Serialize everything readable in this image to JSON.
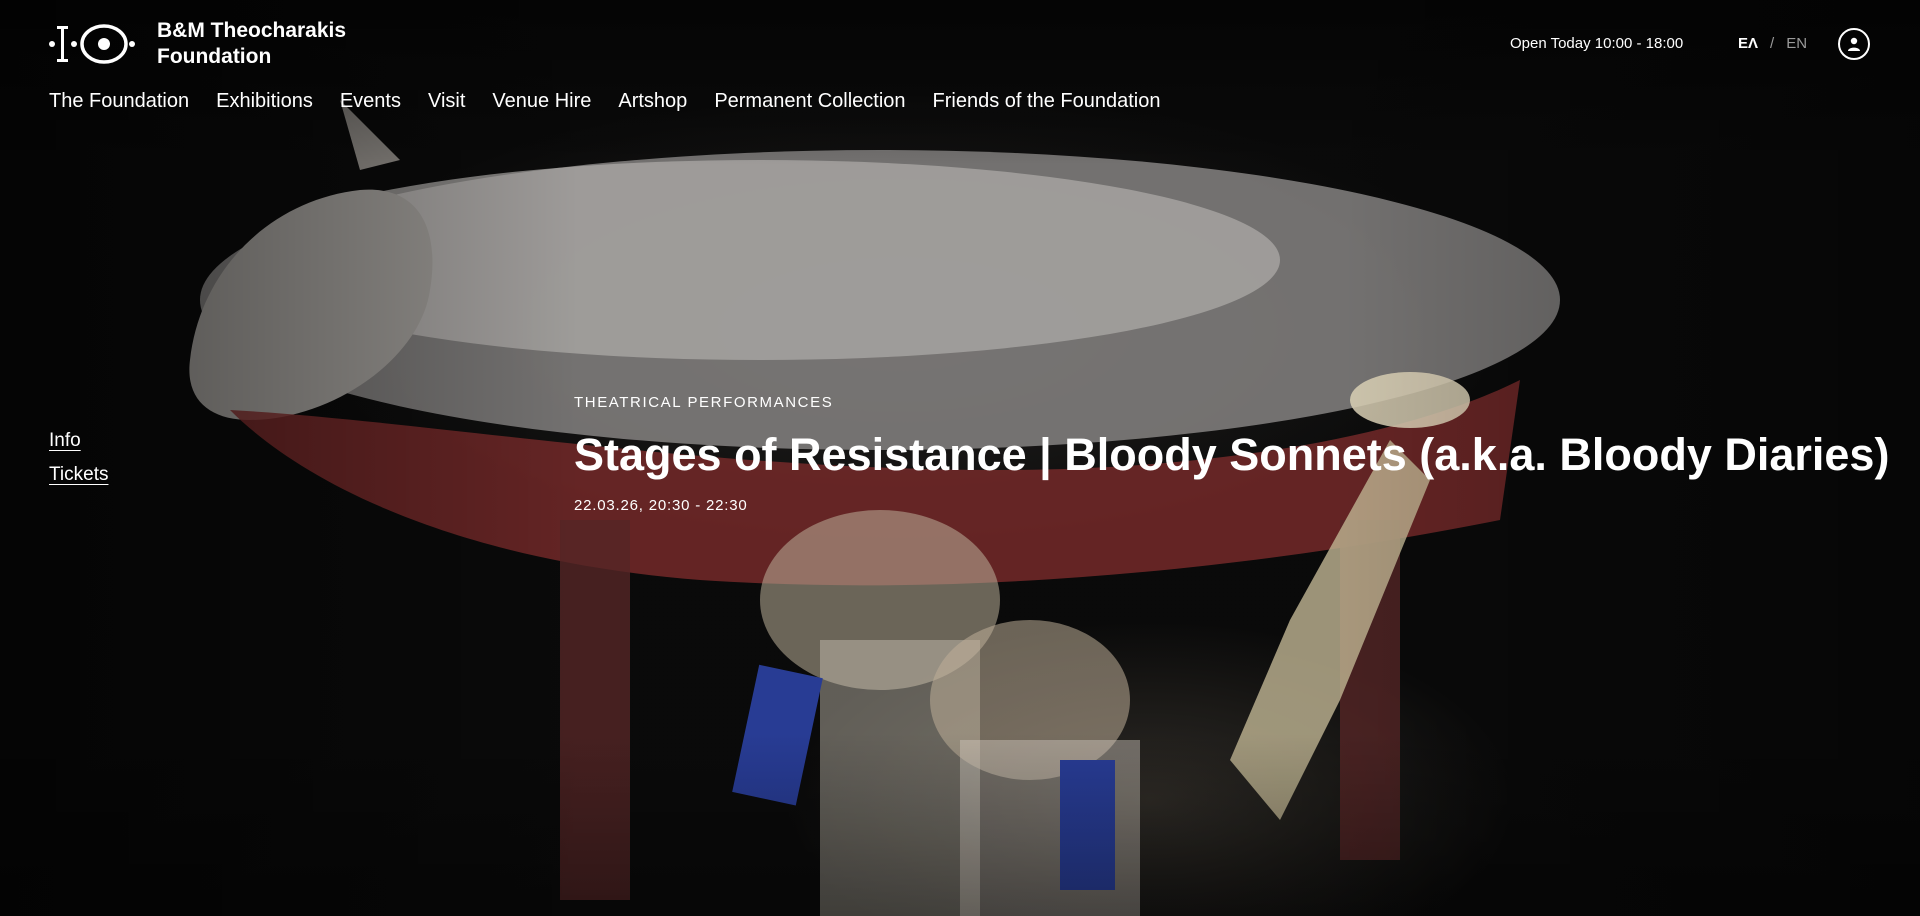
{
  "brand": {
    "name_line1": "B&M Theocharakis",
    "name_line2": "Foundation"
  },
  "header": {
    "hours": "Open Today 10:00 - 18:00",
    "lang_active": "ΕΛ",
    "lang_separator": "/",
    "lang_inactive": "EN"
  },
  "nav": {
    "items": [
      "The Foundation",
      "Exhibitions",
      "Events",
      "Visit",
      "Venue Hire",
      "Artshop",
      "Permanent Collection",
      "Friends of the Foundation"
    ]
  },
  "side": {
    "info": "Info",
    "tickets": "Tickets"
  },
  "event": {
    "category": "THEATRICAL PERFORMANCES",
    "title": "Stages of Resistance | Bloody Sonnets (a.k.a. Bloody Diaries)",
    "datetime": "22.03.26, 20:30 - 22:30"
  },
  "icons": {
    "logo": "foundation-logo-icon",
    "account": "user-icon"
  },
  "colors": {
    "text": "#ffffff",
    "muted": "#9a9a9a",
    "background": "#0b0b0b"
  }
}
